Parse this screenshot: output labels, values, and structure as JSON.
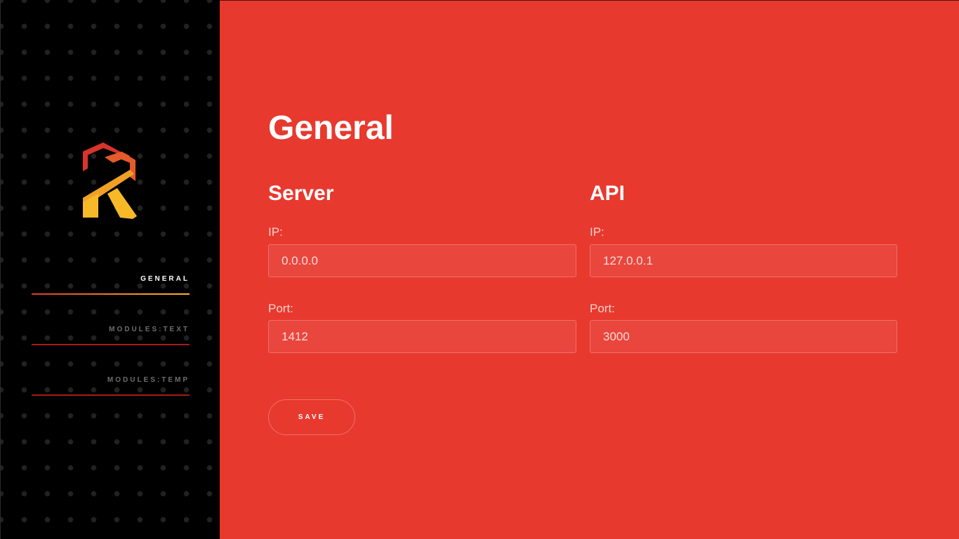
{
  "sidebar": {
    "logo_icon": "app-logo-icon",
    "nav": [
      {
        "label": "GENERAL",
        "active": true
      },
      {
        "label": "MODULES:TEXT",
        "active": false
      },
      {
        "label": "MODULES:TEMP",
        "active": false
      }
    ]
  },
  "main": {
    "title": "General",
    "server": {
      "title": "Server",
      "ip_label": "IP:",
      "ip_value": "0.0.0.0",
      "port_label": "Port:",
      "port_value": "1412"
    },
    "api": {
      "title": "API",
      "ip_label": "IP:",
      "ip_value": "127.0.0.1",
      "port_label": "Port:",
      "port_value": "3000"
    },
    "save_label": "SAVE"
  },
  "colors": {
    "accent": "#e8392e",
    "sidebar_bg": "#000000",
    "logo_red": "#d9342b",
    "logo_orange": "#e45a2a",
    "logo_amber": "#f0a125",
    "logo_yellow": "#f7b928"
  }
}
